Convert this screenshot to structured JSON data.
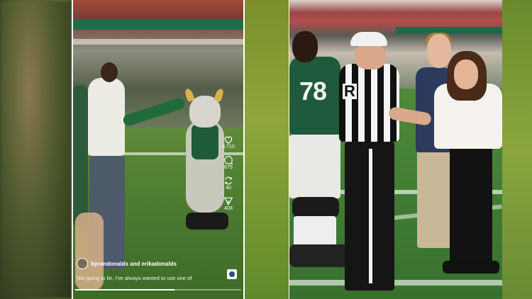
{
  "left_panel": {
    "caption_users": "byrondonalds and erikadonalds",
    "caption_text": "Not going to lie, I've always wanted to use one of",
    "actions": [
      {
        "icon": "heart-icon",
        "count": "4,710"
      },
      {
        "icon": "comment-icon",
        "count": "675"
      },
      {
        "icon": "repost-icon",
        "count": "40"
      },
      {
        "icon": "share-icon",
        "count": "408"
      }
    ],
    "progress": 0.6
  },
  "right_panel": {
    "jersey_number": "78",
    "referee_letter": "R"
  }
}
